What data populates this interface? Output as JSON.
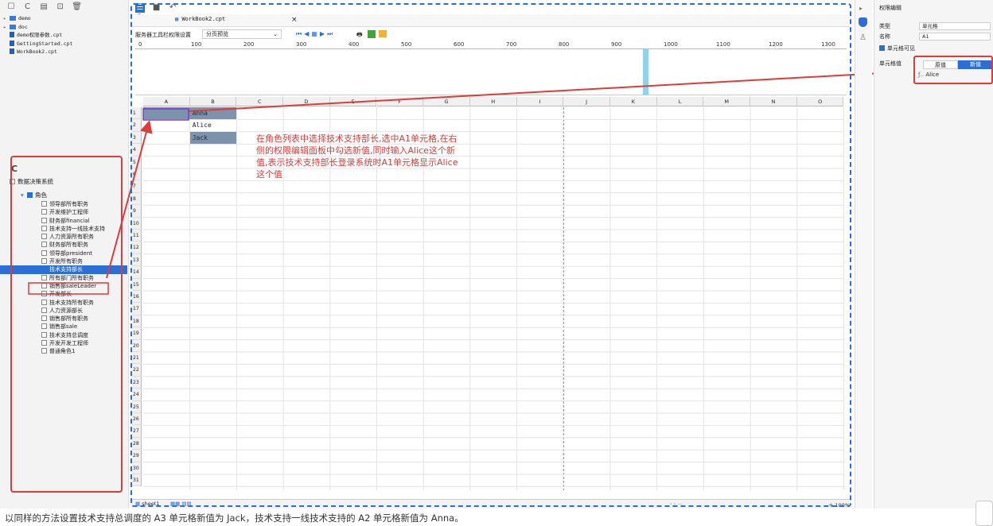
{
  "file_tree": {
    "items": [
      {
        "label": "demo",
        "kind": "folder"
      },
      {
        "label": "doc",
        "kind": "folder"
      },
      {
        "label": "demo权限参数.cpt",
        "kind": "file"
      },
      {
        "label": "GettingStarted.cpt",
        "kind": "file"
      },
      {
        "label": "WorkBook2.cpt",
        "kind": "file"
      }
    ]
  },
  "roles": {
    "root": "数据决策系统",
    "group": "角色",
    "items": [
      {
        "label": "领导部所有职务",
        "checked": false
      },
      {
        "label": "开发维护工程师",
        "checked": false
      },
      {
        "label": "财务部financial",
        "checked": false
      },
      {
        "label": "技术支持一线技术支持",
        "checked": false
      },
      {
        "label": "人力资源所有职务",
        "checked": false
      },
      {
        "label": "财务部所有职务",
        "checked": false
      },
      {
        "label": "领导部president",
        "checked": false
      },
      {
        "label": "开发所有职务",
        "checked": false
      },
      {
        "label": "技术支持部长",
        "checked": true
      },
      {
        "label": "所有部门所有职务",
        "checked": false
      },
      {
        "label": "销售部saleLeader",
        "checked": false
      },
      {
        "label": "开发部长",
        "checked": false
      },
      {
        "label": "技术支持所有职务",
        "checked": false
      },
      {
        "label": "人力资源部长",
        "checked": false
      },
      {
        "label": "销售部所有职务",
        "checked": false
      },
      {
        "label": "销售部sale",
        "checked": false
      },
      {
        "label": "技术支持总调度",
        "checked": false
      },
      {
        "label": "开发开发工程师",
        "checked": false
      },
      {
        "label": "普通角色1",
        "checked": false
      }
    ]
  },
  "editor": {
    "tab_title": "WorkBook2.cpt",
    "toolbar_label": "服务器工具栏权限设置",
    "toolbar_select": "分页预览",
    "ruler_ticks": [
      "0",
      "100",
      "200",
      "300",
      "400",
      "500",
      "600",
      "700",
      "800",
      "900",
      "1000",
      "1100",
      "1200",
      "1300"
    ],
    "columns": [
      "A",
      "B",
      "C",
      "D",
      "E",
      "F",
      "G",
      "H",
      "I",
      "J",
      "K",
      "L",
      "M",
      "N",
      "O"
    ],
    "cells": {
      "B1": "Anna",
      "B2": "Alice",
      "B3": "Jack"
    },
    "sheet_name": "sheet1",
    "zoom": "100%"
  },
  "annotation": "在角色列表中选择技术支持部长,选中A1单元格,在右侧的权限编辑面板中勾选新值,同时输入Alice这个新值,表示技术支持部长登录系统时A1单元格显示Alice这个值",
  "perm_panel": {
    "title": "权限编辑",
    "type_label": "类型",
    "type_value": "单元格",
    "name_label": "名称",
    "name_value": "A1",
    "visible_label": "单元格可见",
    "cell_value_label": "单元格值",
    "seg_original": "原值",
    "seg_new": "新值",
    "new_value": "Alice"
  },
  "caption": "以同样的方法设置技术支持总调度的 A3 单元格新值为 Jack，技术支持一线技术支持的 A2 单元格新值为 Anna。",
  "colors": {
    "accent": "#2b6fd6",
    "annotation": "#e03b3b",
    "cell_fill": "#7c93ab"
  }
}
